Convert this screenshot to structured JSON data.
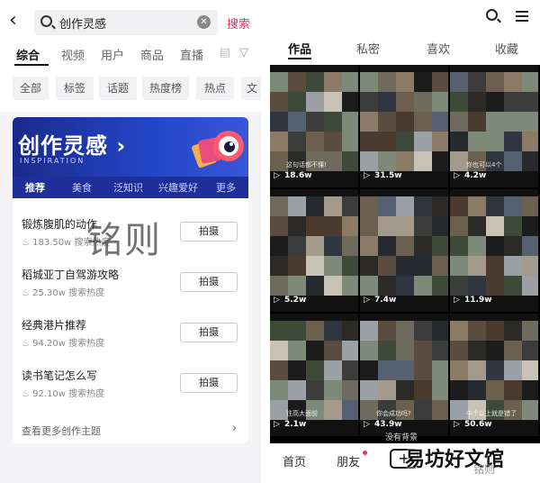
{
  "left": {
    "back_icon": "chevron-left-icon",
    "search_query": "创作灵感",
    "search_button": "搜索",
    "tabs": [
      "综合",
      "视频",
      "用户",
      "商品",
      "直播",
      "▤",
      "▽"
    ],
    "chips": [
      "全部",
      "标签",
      "话题",
      "热度榜",
      "热点",
      "文"
    ],
    "banner": {
      "title": "创作灵感 ›",
      "subtitle": "INSPIRATION",
      "nav": [
        "推荐",
        "美食",
        "泛知识",
        "兴趣爱好",
        "更多"
      ]
    },
    "items": [
      {
        "title": "锻炼腹肌的动作",
        "heat": "183.50w 搜索热度",
        "action": "拍摄"
      },
      {
        "title": "稻城亚丁自驾游攻略",
        "heat": "25.30w 搜索热度",
        "action": "拍摄"
      },
      {
        "title": "经典港片推荐",
        "heat": "94.20w 搜索热度",
        "action": "拍摄"
      },
      {
        "title": "读书笔记怎么写",
        "heat": "92.10w 搜索热度",
        "action": "拍摄"
      }
    ],
    "see_more": "查看更多创作主题",
    "watermark": "铭则"
  },
  "right": {
    "tabs": [
      "作品",
      "私密",
      "喜欢",
      "收藏"
    ],
    "videos": [
      {
        "count": "18.6w",
        "caption": "这句话都不懂!"
      },
      {
        "count": "31.5w",
        "caption": ""
      },
      {
        "count": "4.2w",
        "caption": "你也可以4个"
      },
      {
        "count": "5.2w",
        "caption": ""
      },
      {
        "count": "7.4w",
        "caption": ""
      },
      {
        "count": "11.9w",
        "caption": ""
      },
      {
        "count": "2.1w",
        "caption": "往高大面前"
      },
      {
        "count": "43.9w",
        "caption": "你会成功吗?"
      },
      {
        "count": "50.6w",
        "caption": "中个以上就是错了"
      }
    ],
    "bottom_nav": [
      "首页",
      "朋友",
      "+"
    ],
    "watermark": "易坊好文馆",
    "watermark_small": "铭则",
    "extra_caption": "没有背景"
  },
  "colors": {
    "accent": "#f0325a",
    "banner": "#2446c9"
  }
}
